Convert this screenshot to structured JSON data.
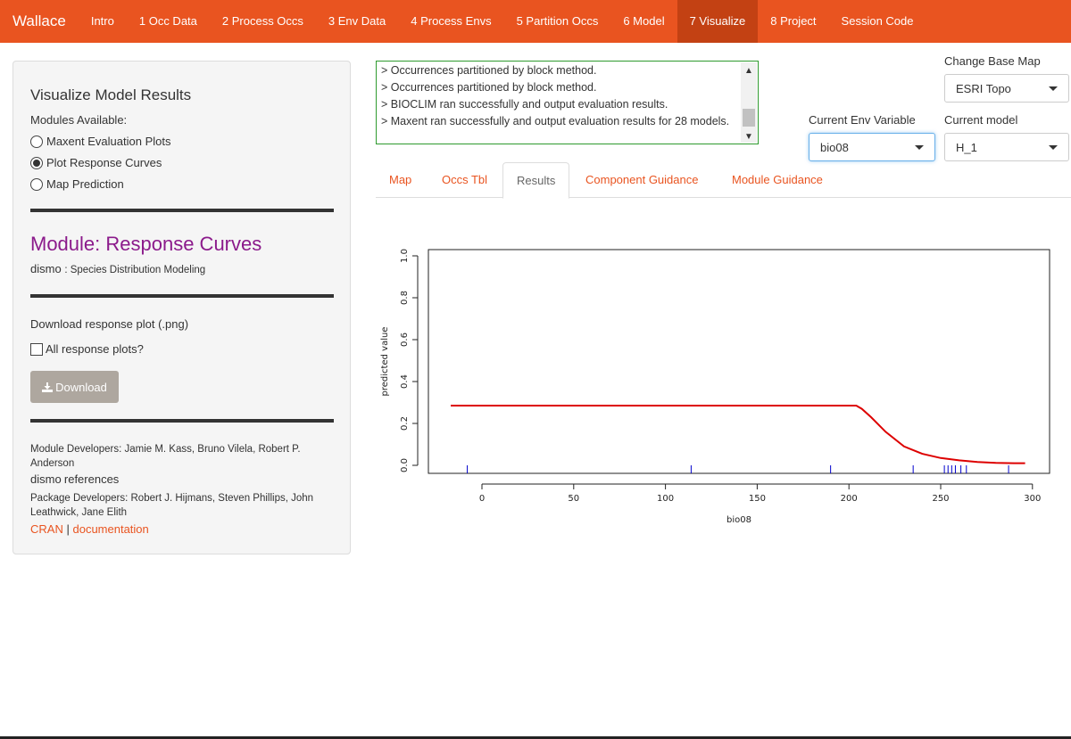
{
  "navbar": {
    "brand": "Wallace",
    "items": [
      "Intro",
      "1 Occ Data",
      "2 Process Occs",
      "3 Env Data",
      "4 Process Envs",
      "5 Partition Occs",
      "6 Model",
      "7 Visualize",
      "8 Project",
      "Session Code"
    ],
    "active_index": 7
  },
  "sidebar": {
    "title": "Visualize Model Results",
    "modules_label": "Modules Available:",
    "modules": [
      {
        "label": "Maxent Evaluation Plots",
        "selected": false
      },
      {
        "label": "Plot Response Curves",
        "selected": true
      },
      {
        "label": "Map Prediction",
        "selected": false
      }
    ],
    "module_title": "Module: Response Curves",
    "package": "dismo",
    "package_desc": ": Species Distribution Modeling",
    "download_label": "Download response plot (.png)",
    "all_plots_label": "All response plots?",
    "download_button": "Download",
    "module_devs": "Module Developers: Jamie M. Kass, Bruno Vilela, Robert P. Anderson",
    "references": "references",
    "package_devs": "Package Developers: Robert J. Hijmans, Steven Phillips, John Leathwick, Jane Elith",
    "link_cran": "CRAN",
    "link_sep": "|",
    "link_docs": "documentation"
  },
  "log": {
    "lines": [
      "> Occurrences partitioned by block method.",
      "> Occurrences partitioned by block method.",
      "> BIOCLIM ran successfully and output evaluation results.",
      "> Maxent ran successfully and output evaluation results for 28 models."
    ]
  },
  "controls": {
    "basemap_label": "Change Base Map",
    "basemap_value": "ESRI Topo",
    "env_label": "Current Env Variable",
    "env_value": "bio08",
    "model_label": "Current model",
    "model_value": "H_1"
  },
  "tabs": [
    "Map",
    "Occs Tbl",
    "Results",
    "Component Guidance",
    "Module Guidance"
  ],
  "active_tab": 2,
  "colors": {
    "accent": "#e95420",
    "module_title": "#8b1a8b",
    "curve": "#dd0000",
    "rug": "#0000cc"
  },
  "chart_data": {
    "type": "line",
    "xlabel": "bio08",
    "ylabel": "predicted value",
    "xlim": [
      -20,
      300
    ],
    "ylim": [
      0,
      1
    ],
    "xticks": [
      0,
      50,
      100,
      150,
      200,
      250,
      300
    ],
    "yticks": [
      0.0,
      0.2,
      0.4,
      0.6,
      0.8,
      1.0
    ],
    "ytick_labels": [
      "0.0",
      "0.2",
      "0.4",
      "0.6",
      "0.8",
      "1.0"
    ],
    "series": [
      {
        "x": [
          -17,
          0,
          50,
          100,
          150,
          200,
          204,
          207,
          212,
          220,
          230,
          240,
          250,
          260,
          270,
          280,
          290,
          296
        ],
        "y": [
          0.285,
          0.285,
          0.285,
          0.285,
          0.285,
          0.285,
          0.285,
          0.27,
          0.23,
          0.16,
          0.09,
          0.055,
          0.035,
          0.024,
          0.016,
          0.012,
          0.01,
          0.01
        ]
      }
    ],
    "rug": [
      -8,
      114,
      190,
      235,
      252,
      254,
      256,
      258,
      261,
      264,
      287
    ]
  }
}
